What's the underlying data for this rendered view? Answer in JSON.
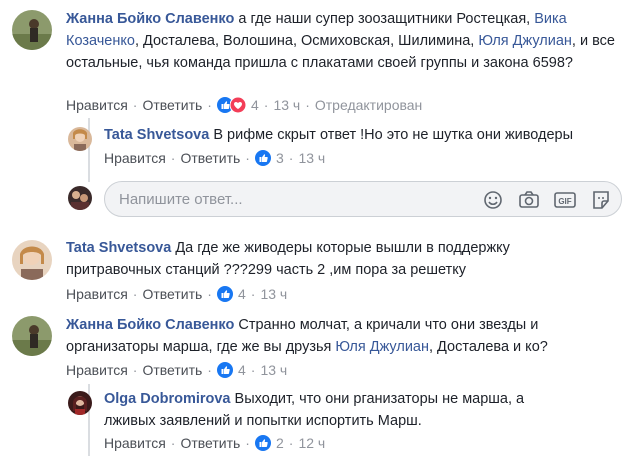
{
  "comments": [
    {
      "author": "Жанна Бойко Славенко",
      "text_parts": [
        {
          "t": " а где наши супер зоозащитники Ростецкая, "
        },
        {
          "t": "Вика",
          "mention": true
        },
        {
          "t": " "
        },
        {
          "t": "Козаченко",
          "mention": true
        },
        {
          "t": ", Досталева, Волошина, Осмиховская, Шилимина, "
        },
        {
          "t": "Юля Джулиан",
          "mention": true
        },
        {
          "t": ", и все остальные, чья команда пришла с плакатами своей группы и закона 6598?"
        }
      ],
      "like": "Нравится",
      "reply": "Ответить",
      "reactions": "4",
      "time": "13 ч",
      "edited": "Отредактирован"
    },
    {
      "author": "Tata Shvetsova",
      "text": "В рифме скрыт ответ !Но это не шутка они живодеры",
      "like": "Нравится",
      "reply": "Ответить",
      "reactions": "3",
      "time": "13 ч"
    },
    {
      "author": "Tata Shvetsova",
      "text": "Да где же живодеры которые вышли в поддержку притравочных станций ???299 часть 2 ,им пора за решетку",
      "like": "Нравится",
      "reply": "Ответить",
      "reactions": "4",
      "time": "13 ч"
    },
    {
      "author": "Жанна Бойко Славенко",
      "text_before": " Странно молчат, а кричали что они звезды и организаторы марша, где же вы друзья ",
      "mention": "Юля Джулиан",
      "text_after": ", Досталева и ко?",
      "like": "Нравится",
      "reply": "Ответить",
      "reactions": "4",
      "time": "13 ч"
    },
    {
      "author": "Olga Dobromirova",
      "text": "Выходит, что они рганизаторы не марша, а лживых заявлений и попытки испортить Марш.",
      "like": "Нравится",
      "reply": "Ответить",
      "reactions": "2",
      "time": "12 ч"
    }
  ],
  "reply_box": {
    "placeholder": "Напишите ответ..."
  },
  "colors": {
    "link": "#385898",
    "like": "#1877f2",
    "love": "#f33e58",
    "line": "#dadde1"
  }
}
